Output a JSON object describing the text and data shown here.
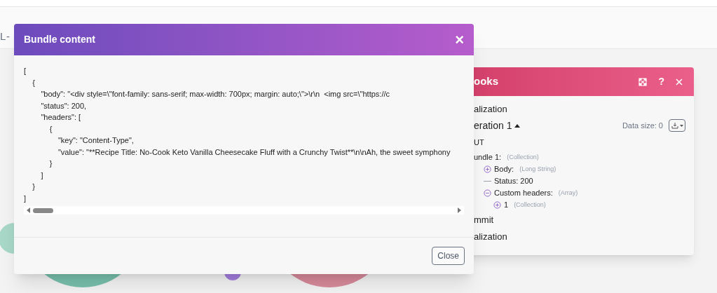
{
  "canvas": {
    "fragment": "L-"
  },
  "panel": {
    "title": "ooks",
    "help": "?",
    "items": [
      {
        "kind": "section",
        "text": "alization"
      },
      {
        "kind": "operation",
        "text": "eration 1",
        "expanded": true,
        "data_size": "Data size: 0"
      },
      {
        "kind": "heading",
        "text": "UT"
      }
    ],
    "tree": [
      {
        "label": "undle 1:",
        "type": "(Collection)",
        "children": [
          {
            "label": "Body:",
            "type": "(Long String)",
            "expanded": false
          },
          {
            "label": "Status: 200"
          },
          {
            "label": "Custom headers:",
            "type": "(Array)",
            "expanded": true,
            "children": [
              {
                "label": "1",
                "type": "(Collection)",
                "expanded": false
              }
            ]
          }
        ]
      }
    ],
    "footer_items": [
      "mmit",
      "alization"
    ]
  },
  "modal": {
    "title": "Bundle content",
    "close_icon": "×",
    "lines": [
      "[",
      "    {",
      "        \"body\": \"<div style=\\\"font-family: sans-serif; max-width: 700px; margin: auto;\\\">\\r\\n  <img src=\\\"https://c",
      "        \"status\": 200,",
      "        \"headers\": [",
      "            {",
      "                \"key\": \"Content-Type\",",
      "                \"value\": \"**Recipe Title: No-Cook Keto Vanilla Cheesecake Fluff with a Crunchy Twist**\\n\\nAh, the sweet symphony",
      "            }",
      "        ]",
      "    }",
      "]"
    ],
    "button": "Close"
  }
}
